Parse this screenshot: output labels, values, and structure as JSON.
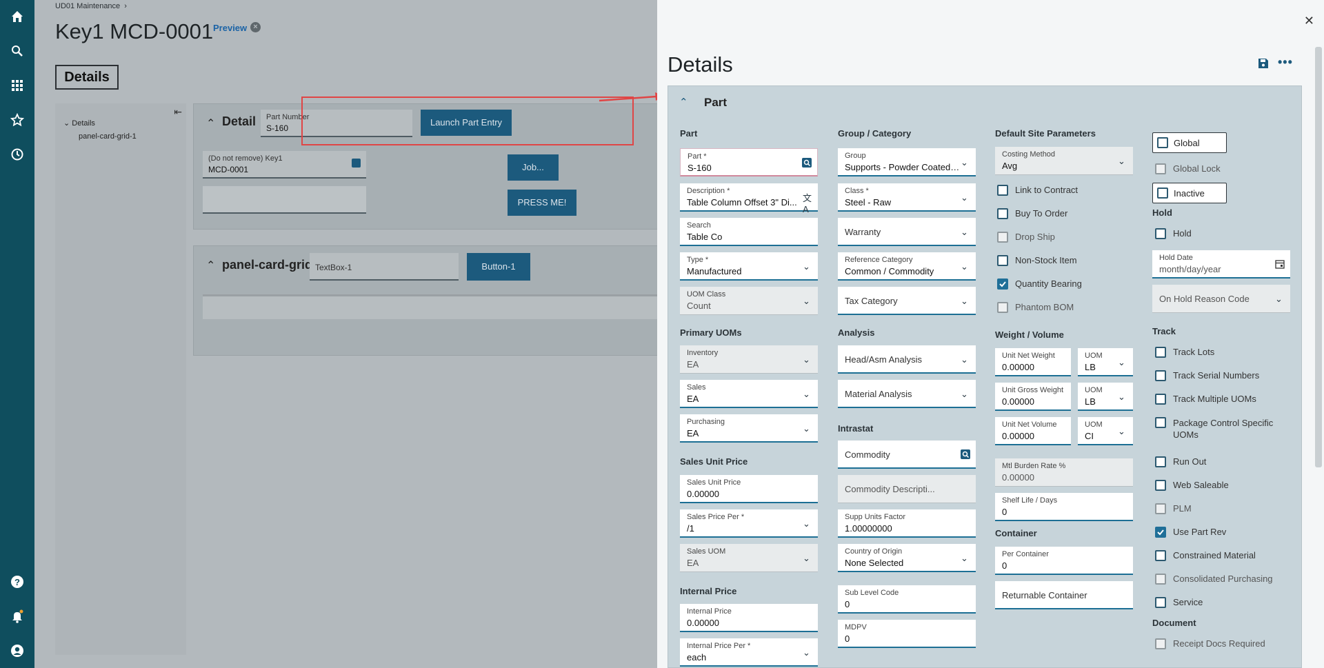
{
  "nav": {
    "icons": [
      "home-icon",
      "search-icon",
      "apps-grid-icon",
      "star-icon",
      "history-icon",
      "help-icon",
      "notifications-icon",
      "user-icon"
    ]
  },
  "background": {
    "breadcrumb": "UD01 Maintenance",
    "title": "Key1 MCD-0001",
    "preview": "Preview",
    "details_tab": "Details",
    "tree": {
      "root": "Details",
      "child": "panel-card-grid-1"
    },
    "detail_card": {
      "title": "Detail",
      "part_number_label": "Part Number",
      "part_number_value": "S-160",
      "launch_button": "Launch Part Entry",
      "key1_label": "(Do not remove) Key1",
      "key1_value": "MCD-0001",
      "job_button": "Job...",
      "press_button": "PRESS ME!"
    },
    "grid_card": {
      "title": "panel-card-grid-1",
      "textbox": "TextBox-1",
      "button": "Button-1"
    }
  },
  "drawer": {
    "title": "Details",
    "section_title": "Part",
    "col1": {
      "part_header": "Part",
      "part": {
        "label": "Part *",
        "value": "S-160"
      },
      "description": {
        "label": "Description *",
        "value": "Table Column Offset 3\" Di..."
      },
      "search": {
        "label": "Search",
        "value": "Table Co"
      },
      "type": {
        "label": "Type *",
        "value": "Manufactured"
      },
      "uom_class": {
        "label": "UOM Class",
        "value": "Count"
      },
      "primary_uoms_header": "Primary UOMs",
      "inventory": {
        "label": "Inventory",
        "value": "EA"
      },
      "sales": {
        "label": "Sales",
        "value": "EA"
      },
      "purchasing": {
        "label": "Purchasing",
        "value": "EA"
      },
      "sales_unit_price_header": "Sales Unit Price",
      "sales_unit_price": {
        "label": "Sales Unit Price",
        "value": "0.00000"
      },
      "sales_price_per": {
        "label": "Sales Price Per *",
        "value": "/1"
      },
      "sales_uom": {
        "label": "Sales UOM",
        "value": "EA"
      },
      "internal_price_header": "Internal Price",
      "internal_price": {
        "label": "Internal Price",
        "value": "0.00000"
      },
      "internal_price_per": {
        "label": "Internal Price Per *",
        "value": "each"
      }
    },
    "col2": {
      "group_header": "Group / Category",
      "group": {
        "label": "Group",
        "value": "Supports - Powder Coated S..."
      },
      "class": {
        "label": "Class *",
        "value": "Steel - Raw"
      },
      "warranty": "Warranty",
      "reference_category": {
        "label": "Reference Category",
        "value": "Common / Commodity"
      },
      "tax_category": "Tax Category",
      "analysis_header": "Analysis",
      "head_asm": "Head/Asm Analysis",
      "material_analysis": "Material Analysis",
      "intrastat_header": "Intrastat",
      "commodity": "Commodity",
      "commodity_desc": "Commodity Descripti...",
      "supp_units_factor": {
        "label": "Supp Units Factor",
        "value": "1.00000000"
      },
      "country_of_origin": {
        "label": "Country of Origin",
        "value": "None Selected"
      },
      "sub_level_code": {
        "label": "Sub Level Code",
        "value": "0"
      },
      "mdpv": {
        "label": "MDPV",
        "value": "0"
      }
    },
    "col3": {
      "default_site_header": "Default Site Parameters",
      "costing_method": {
        "label": "Costing Method",
        "value": "Avg"
      },
      "link_to_contract": "Link to Contract",
      "buy_to_order": "Buy To Order",
      "drop_ship": "Drop Ship",
      "non_stock_item": "Non-Stock Item",
      "quantity_bearing": "Quantity Bearing",
      "phantom_bom": "Phantom BOM",
      "weight_volume_header": "Weight / Volume",
      "unit_net_weight": {
        "label": "Unit Net Weight",
        "value": "0.00000"
      },
      "uom1": {
        "label": "UOM",
        "value": "LB"
      },
      "unit_gross_weight": {
        "label": "Unit Gross Weight",
        "value": "0.00000"
      },
      "uom2": {
        "label": "UOM",
        "value": "LB"
      },
      "unit_net_volume": {
        "label": "Unit Net Volume",
        "value": "0.00000"
      },
      "uom3": {
        "label": "UOM",
        "value": "CI"
      },
      "mtl_burden_rate": {
        "label": "Mtl Burden Rate %",
        "value": "0.00000"
      },
      "shelf_life": {
        "label": "Shelf Life / Days",
        "value": "0"
      },
      "container_header": "Container",
      "per_container": {
        "label": "Per Container",
        "value": "0"
      },
      "returnable_container": "Returnable Container"
    },
    "col4": {
      "global": "Global",
      "global_lock": "Global Lock",
      "inactive": "Inactive",
      "hold_header": "Hold",
      "hold": "Hold",
      "hold_date": {
        "label": "Hold Date",
        "value": "month/day/year"
      },
      "on_hold_reason": "On Hold Reason Code",
      "track_header": "Track",
      "track_lots": "Track Lots",
      "track_serial": "Track Serial Numbers",
      "track_multiple_uoms": "Track Multiple UOMs",
      "package_control": "Package Control Specific UOMs",
      "run_out": "Run Out",
      "web_saleable": "Web Saleable",
      "plm": "PLM",
      "use_part_rev": "Use Part Rev",
      "constrained_material": "Constrained Material",
      "consolidated_purchasing": "Consolidated Purchasing",
      "service": "Service",
      "document_header": "Document",
      "receipt_docs": "Receipt Docs Required"
    }
  },
  "colors": {
    "nav": "#0f4e5e",
    "accent": "#1c6f94",
    "button": "#1c5a7d",
    "highlight": "#e04545"
  }
}
